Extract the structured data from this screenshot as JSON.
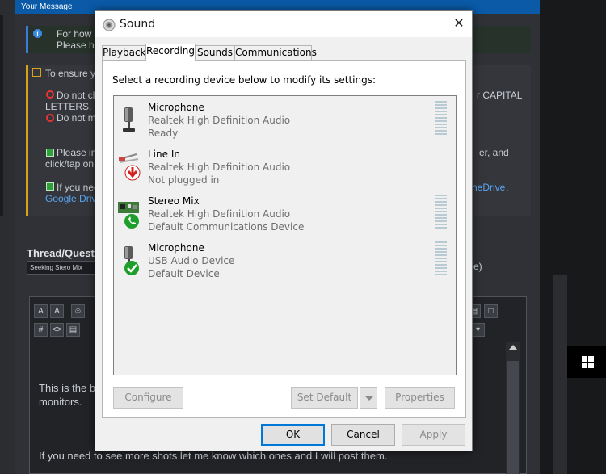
{
  "background": {
    "header_label": "Your Message",
    "info_line_1": "For how",
    "info_line_2": "Please h",
    "ensure_line": "To ensure y",
    "rule_1_start": "Do not cl",
    "rule_1_end": "r CAPITAL",
    "rule_1_cont": "LETTERS.",
    "rule_2": "Do not m",
    "tip_1_start": "Please in",
    "tip_1_end": "er, and",
    "tip_1_cont": "click/tap on",
    "tip_2_start": "If you nee",
    "tip_2_link": "neDrive",
    "tip_2_comma": ",",
    "tip_2_link2": "Google Driv",
    "thread_label": "Thread/Questi",
    "thread_value": "Seeking Stero Mix",
    "thread_suffix": "ve)",
    "body_line_1": "This is the b",
    "body_line_2": "monitors.",
    "body_line_3": "If you need to see more shots let me know which ones and I will post them."
  },
  "dialog": {
    "title": "Sound",
    "close_glyph": "✕",
    "tabs": [
      {
        "label": "Playback"
      },
      {
        "label": "Recording"
      },
      {
        "label": "Sounds"
      },
      {
        "label": "Communications"
      }
    ],
    "active_tab": "Recording",
    "instruction": "Select a recording device below to modify its settings:",
    "devices": [
      {
        "name": "Microphone",
        "driver": "Realtek High Definition Audio",
        "status": "Ready",
        "icon": "microphone-icon",
        "badge": "none"
      },
      {
        "name": "Line In",
        "driver": "Realtek High Definition Audio",
        "status": "Not plugged in",
        "icon": "line-in-icon",
        "badge": "red-down-arrow"
      },
      {
        "name": "Stereo Mix",
        "driver": "Realtek High Definition Audio",
        "status": "Default Communications Device",
        "icon": "sound-card-icon",
        "badge": "green-phone"
      },
      {
        "name": "Microphone",
        "driver": "USB Audio Device",
        "status": "Default Device",
        "icon": "microphone-icon",
        "badge": "green-check"
      }
    ],
    "buttons": {
      "configure": "Configure",
      "set_default": "Set Default",
      "properties": "Properties",
      "ok": "OK",
      "cancel": "Cancel",
      "apply": "Apply"
    }
  },
  "colors": {
    "accent": "#0078d7",
    "meter": "#b8cbd2",
    "badge_green": "#1e9e2a",
    "badge_red": "#d32020"
  }
}
